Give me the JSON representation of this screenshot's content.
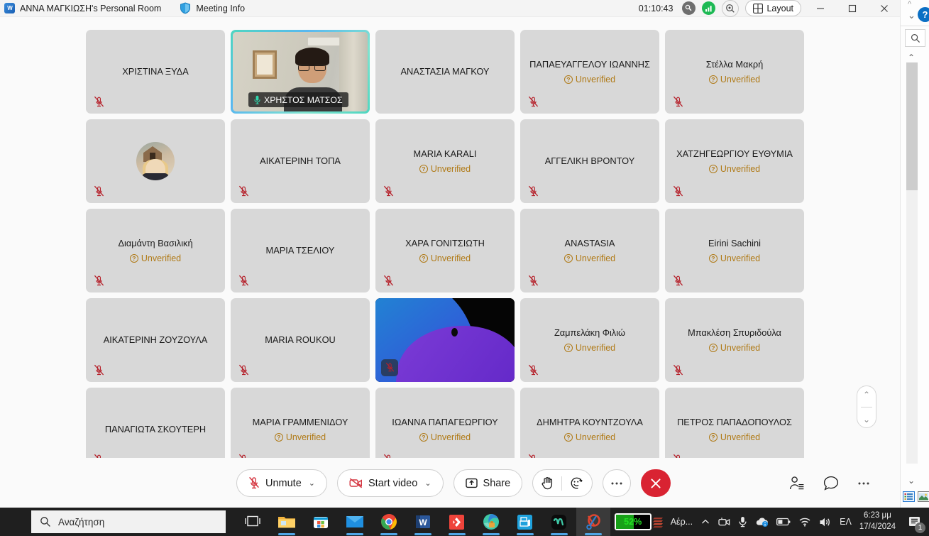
{
  "titlebar": {
    "logo_icon": "webex-logo-icon",
    "room_title": "ANNA ΜΑΓΚΙΩΣΗ's Personal Room",
    "shield_icon": "shield-icon",
    "meeting_info_label": "Meeting Info",
    "elapsed_time": "01:10:43",
    "key_icon": "key-icon",
    "network_icon": "network-quality-icon",
    "zoom_icon": "zoom-view-icon",
    "layout_icon": "layout-grid-icon",
    "layout_label": "Layout",
    "minimize_icon": "minimize-icon",
    "maximize_icon": "maximize-icon",
    "close_icon": "close-icon"
  },
  "rail": {
    "chev_up_icon": "chevron-up-icon",
    "chev_down_icon": "chevron-down-icon",
    "help_label": "?",
    "search_icon": "search-icon",
    "scroll_up_icon": "scroll-up-icon",
    "scroll_down_icon": "scroll-down-icon",
    "view_list_icon": "view-list-icon",
    "view_thumbnail_icon": "view-thumbnail-icon"
  },
  "stage": {
    "unverified_label": "Unverified",
    "mute_icon": "microphone-muted-icon",
    "active_speaker_mic_icon": "microphone-active-icon",
    "stepper_up_icon": "chevron-up-icon",
    "stepper_down_icon": "chevron-down-icon",
    "participants": [
      {
        "name": "ΧΡΙΣΤΙΝΑ ΞΥΔΑ",
        "unverified": false,
        "muted": true,
        "type": "name"
      },
      {
        "name": "ΧΡΗΣΤΟΣ ΜΑΤΣΟΣ",
        "unverified": false,
        "muted": false,
        "type": "video-active"
      },
      {
        "name": "ΑΝΑΣΤΑΣΙΑ ΜΑΓΚΟΥ",
        "unverified": false,
        "muted": false,
        "type": "name"
      },
      {
        "name": "ΠΑΠΑΕΥΑΓΓΕΛΟΥ ΙΩΑΝΝΗΣ",
        "unverified": true,
        "muted": true,
        "type": "name"
      },
      {
        "name": "Στέλλα Μακρή",
        "unverified": true,
        "muted": true,
        "type": "name"
      },
      {
        "name": "",
        "unverified": false,
        "muted": true,
        "type": "avatar"
      },
      {
        "name": "ΑΙΚΑΤΕΡΙΝΗ ΤΟΠΑ",
        "unverified": false,
        "muted": true,
        "type": "name"
      },
      {
        "name": "MARIA KARALI",
        "unverified": true,
        "muted": true,
        "type": "name"
      },
      {
        "name": "ΑΓΓΕΛΙΚΗ ΒΡΟΝΤΟΥ",
        "unverified": false,
        "muted": true,
        "type": "name"
      },
      {
        "name": "ΧΑΤΖΗΓΕΩΡΓΙΟΥ ΕΥΘΥΜΙΑ",
        "unverified": true,
        "muted": true,
        "type": "name"
      },
      {
        "name": "Διαμάντη Βασιλική",
        "unverified": true,
        "muted": true,
        "type": "name"
      },
      {
        "name": "ΜΑΡΙΑ ΤΣΕΛΙΟΥ",
        "unverified": false,
        "muted": true,
        "type": "name"
      },
      {
        "name": "ΧΑΡΑ ΓΟΝΙΤΣΙΩΤΗ",
        "unverified": true,
        "muted": true,
        "type": "name"
      },
      {
        "name": "ANASTASIA",
        "unverified": true,
        "muted": true,
        "type": "name"
      },
      {
        "name": "Eirini Sachini",
        "unverified": true,
        "muted": true,
        "type": "name"
      },
      {
        "name": "ΑΙΚΑΤΕΡΙΝΗ ΖΟΥΖΟΥΛΑ",
        "unverified": false,
        "muted": true,
        "type": "name"
      },
      {
        "name": "MARIA ROUKOU",
        "unverified": false,
        "muted": true,
        "type": "name"
      },
      {
        "name": "",
        "unverified": false,
        "muted": true,
        "type": "video-purple"
      },
      {
        "name": "Ζαμπελάκη Φιλιώ",
        "unverified": true,
        "muted": true,
        "type": "name"
      },
      {
        "name": "Μπακλέση Σπυριδούλα",
        "unverified": true,
        "muted": true,
        "type": "name"
      },
      {
        "name": "ΠΑΝΑΓΙΩΤΑ ΣΚΟΥΤΕΡΗ",
        "unverified": false,
        "muted": true,
        "type": "name"
      },
      {
        "name": "ΜΑΡΙΑ ΓΡΑΜΜΕΝΙΔΟΥ",
        "unverified": true,
        "muted": true,
        "type": "name"
      },
      {
        "name": "ΙΩΑΝΝΑ ΠΑΠΑΓΕΩΡΓΙΟΥ",
        "unverified": true,
        "muted": true,
        "type": "name"
      },
      {
        "name": "ΔΗΜΗΤΡΑ ΚΟΥΝΤΖΟΥΛΑ",
        "unverified": true,
        "muted": true,
        "type": "name"
      },
      {
        "name": "ΠΕΤΡΟΣ ΠΑΠΑΔΟΠΟΥΛΟΣ",
        "unverified": true,
        "muted": true,
        "type": "name"
      }
    ]
  },
  "controlbar": {
    "mute_icon": "microphone-muted-icon",
    "mute_label": "Unmute",
    "video_icon": "camera-off-icon",
    "video_label": "Start video",
    "share_icon": "share-screen-icon",
    "share_label": "Share",
    "raise_hand_icon": "raise-hand-icon",
    "reactions_icon": "reactions-smiley-icon",
    "more_icon": "more-options-icon",
    "leave_icon": "leave-meeting-icon",
    "participants_icon": "participants-icon",
    "chat_icon": "chat-bubble-icon",
    "more_right_icon": "more-options-icon"
  },
  "taskbar": {
    "search_icon": "search-icon",
    "search_placeholder": "Αναζήτηση",
    "icons": [
      "task-view-icon",
      "file-explorer-icon",
      "microsoft-store-icon",
      "mail-icon",
      "google-chrome-icon",
      "microsoft-word-icon",
      "anydesk-icon",
      "microsoft-edge-icon",
      "printer-app-icon",
      "webex-teams-icon",
      "snipping-tool-icon"
    ],
    "battery_percent": "52%",
    "tray_app_icon": "aeroplan-app-icon",
    "tray_app_label": "Αέρ...",
    "tray_chevron_icon": "show-hidden-icons-icon",
    "tray_camera_icon": "camera-icon",
    "tray_mic_icon": "microphone-icon",
    "tray_onedrive_icon": "onedrive-sync-icon",
    "tray_battery_icon": "battery-icon",
    "tray_wifi_icon": "wifi-icon",
    "tray_volume_icon": "volume-icon",
    "language": "ΕΛ",
    "time": "6:23 μμ",
    "date": "17/4/2024",
    "notification_icon": "notifications-icon",
    "notification_count": "1"
  }
}
